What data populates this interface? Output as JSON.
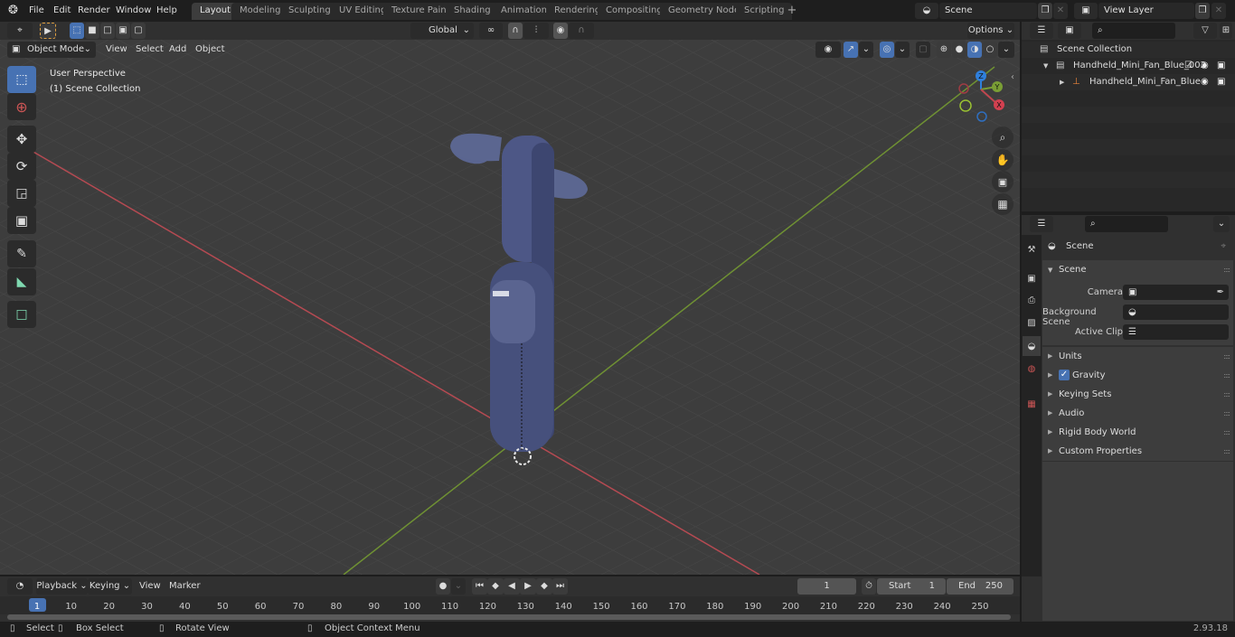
{
  "app": {
    "version": "2.93.18"
  },
  "menu": [
    "File",
    "Edit",
    "Render",
    "Window",
    "Help"
  ],
  "workspaces": [
    {
      "label": "Layout",
      "active": true
    },
    {
      "label": "Modeling"
    },
    {
      "label": "Sculpting"
    },
    {
      "label": "UV Editing"
    },
    {
      "label": "Texture Paint"
    },
    {
      "label": "Shading"
    },
    {
      "label": "Animation"
    },
    {
      "label": "Rendering"
    },
    {
      "label": "Compositing"
    },
    {
      "label": "Geometry Nodes"
    },
    {
      "label": "Scripting"
    }
  ],
  "add_workspace": "+",
  "scene_selector": {
    "value": "Scene"
  },
  "view_layer_selector": {
    "value": "View Layer"
  },
  "viewport": {
    "mode": "Object Mode",
    "menus": [
      "View",
      "Select",
      "Add",
      "Object"
    ],
    "transform_orientation": "Global",
    "options_label": "Options",
    "overlay_text_1": "User Perspective",
    "overlay_text_2": "(1) Scene Collection",
    "gizmo": {
      "x": "X",
      "y": "Y",
      "z": "Z"
    },
    "colors": {
      "x_axis": "#c0474f",
      "y_axis": "#7a9e35",
      "z_axis": "#2f7fdc",
      "object": "#4a5580",
      "bg": "#3d3d3d",
      "grid": "#4a4a4a"
    }
  },
  "tools": [
    "select-box",
    "cursor",
    "move",
    "rotate",
    "scale",
    "transform",
    "annotate",
    "measure",
    "add-cube"
  ],
  "outliner": {
    "root": "Scene Collection",
    "items": [
      {
        "name": "Handheld_Mini_Fan_Blue_002",
        "type": "collection",
        "expanded": true,
        "checked": true
      },
      {
        "name": "Handheld_Mini_Fan_Blue",
        "type": "empty",
        "expanded": false
      }
    ]
  },
  "properties": {
    "context": "Scene",
    "panel_title": "Scene",
    "fields": [
      {
        "label": "Camera",
        "value": ""
      },
      {
        "label": "Background Scene",
        "value": ""
      },
      {
        "label": "Active Clip",
        "value": ""
      }
    ],
    "subpanels": [
      "Units",
      "Gravity",
      "Keying Sets",
      "Audio",
      "Rigid Body World",
      "Custom Properties"
    ],
    "gravity_checked": true
  },
  "timeline": {
    "menus": [
      "Playback",
      "Keying",
      "View",
      "Marker"
    ],
    "current_frame": "1",
    "start_label": "Start",
    "start": "1",
    "end_label": "End",
    "end": "250",
    "ticks": [
      "1",
      "10",
      "20",
      "30",
      "40",
      "50",
      "60",
      "70",
      "80",
      "90",
      "100",
      "110",
      "120",
      "130",
      "140",
      "150",
      "160",
      "170",
      "180",
      "190",
      "200",
      "210",
      "220",
      "230",
      "240",
      "250"
    ]
  },
  "status_bar": {
    "select": "Select",
    "box_select": "Box Select",
    "rotate_view": "Rotate View",
    "context_menu": "Object Context Menu"
  }
}
